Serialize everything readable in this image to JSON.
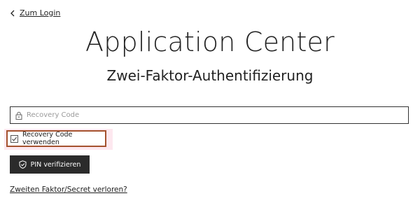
{
  "nav": {
    "back_label": "Zum Login"
  },
  "header": {
    "title": "Application Center",
    "subtitle": "Zwei-Faktor-Authentifizierung"
  },
  "form": {
    "recovery_input": {
      "placeholder": "Recovery Code",
      "value": ""
    },
    "use_recovery_checkbox": {
      "label": "Recovery Code verwenden",
      "checked": true
    },
    "verify_button_label": "PIN verifizieren",
    "lost_factor_link": "Zweiten Faktor/Secret verloren?"
  },
  "icons": {
    "back": "chevron-left-icon",
    "input": "lock-icon",
    "checkbox": "check-icon",
    "button": "shield-icon"
  },
  "colors": {
    "button_bg": "#2b2b2b",
    "highlight_border": "#a5522f",
    "highlight_bg": "#fde8ef"
  }
}
